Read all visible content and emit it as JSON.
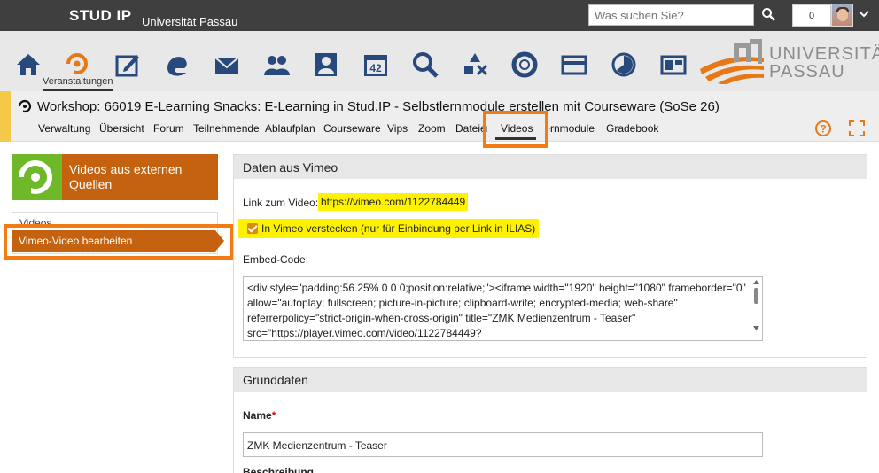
{
  "topbar": {
    "logo": "STUD IP",
    "university": "Universität Passau",
    "search_placeholder": "Was suchen Sie?",
    "notification_count": "0"
  },
  "nav": {
    "active_label": "Veranstaltungen",
    "icons": [
      "home-icon",
      "courses-icon",
      "messages-edit-icon",
      "community-icon",
      "mail-icon",
      "people-icon",
      "profile-icon",
      "calendar-icon",
      "search-icon",
      "tools-icon",
      "support-icon",
      "card-icon",
      "stats-icon",
      "layout-icon"
    ],
    "calendar_number": "42",
    "uni_logo_line1": "UNIVERSITÄT",
    "uni_logo_line2": "PASSAU"
  },
  "course": {
    "title": "Workshop: 66019 E-Learning Snacks: E-Learning in Stud.IP - Selbstlernmodule erstellen mit Courseware (SoSe 26)",
    "tabs": [
      "Verwaltung",
      "Übersicht",
      "Forum",
      "Teilnehmende",
      "Ablaufplan",
      "Courseware",
      "Vips",
      "Zoom",
      "Dateien",
      "Videos",
      "Selbstlernmodule",
      "Gradebook"
    ],
    "active_tab": "Videos"
  },
  "sidebar": {
    "header": "Videos aus externen Quellen",
    "items": [
      "Videos",
      "Vimeo-Video bearbeiten"
    ]
  },
  "vimeo_panel": {
    "title": "Daten aus Vimeo",
    "link_label": "Link zum Video:",
    "link_value": "https://vimeo.com/1122784449",
    "hide_label": "In Vimeo verstecken (nur für Einbindung per Link in ILIAS)",
    "hide_checked": true,
    "embed_label": "Embed-Code:",
    "embed_code": "<div style=\"padding:56.25% 0 0 0;position:relative;\"><iframe width=\"1920\" height=\"1080\" frameborder=\"0\" allow=\"autoplay; fullscreen; picture-in-picture; clipboard-write; encrypted-media; web-share\" referrerpolicy=\"strict-origin-when-cross-origin\" title=\"ZMK Medienzentrum - Teaser\" src=\"https://player.vimeo.com/video/1122784449?"
  },
  "grund_panel": {
    "title": "Grunddaten",
    "name_label": "Name",
    "required_marker": "*",
    "name_value": "ZMK Medienzentrum - Teaser",
    "desc_label": "Beschreibung"
  },
  "colors": {
    "accent_orange": "#c4620f",
    "highlight_orange": "#f27b13",
    "highlight_yellow": "#fff200",
    "green": "#6fb82a",
    "course_accent": "#f6c84a"
  }
}
